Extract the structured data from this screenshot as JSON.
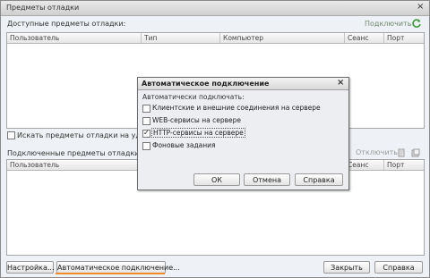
{
  "window": {
    "title": "Предметы отладки",
    "close": "×"
  },
  "available": {
    "label": "Доступные предметы отладки:",
    "connect": "Подключить",
    "columns": [
      "Пользователь",
      "Тип",
      "Компьютер",
      "Сеанс",
      "Порт"
    ]
  },
  "search_checkbox_label": "Искать предметы отладки на удаленном",
  "connected": {
    "label": "Подключенные предметы отладки:",
    "disconnect": "Отключить",
    "columns": [
      "Пользователь",
      "Сеанс",
      "Порт"
    ]
  },
  "footer": {
    "settings": "Настройка...",
    "auto_connect": "Автоматическое подключение...",
    "close": "Закрыть",
    "help": "Справка"
  },
  "dialog": {
    "title": "Автоматическое подключение",
    "close": "×",
    "subtitle": "Автоматически подключать:",
    "options": [
      {
        "label": "Клиентские и внешние соединения на сервере",
        "checked": false
      },
      {
        "label": "WEB-сервисы на сервере",
        "checked": false
      },
      {
        "label": "HTTP-сервисы на сервере",
        "checked": true
      },
      {
        "label": "Фоновые задания",
        "checked": false
      }
    ],
    "ok": "ОК",
    "cancel": "Отмена",
    "help": "Справка",
    "check_glyph": "✓"
  },
  "colors": {
    "accent_link": "#6e8a6e",
    "refresh_icon": "#3a9a3a",
    "orange_underline": "#f08a2c"
  }
}
